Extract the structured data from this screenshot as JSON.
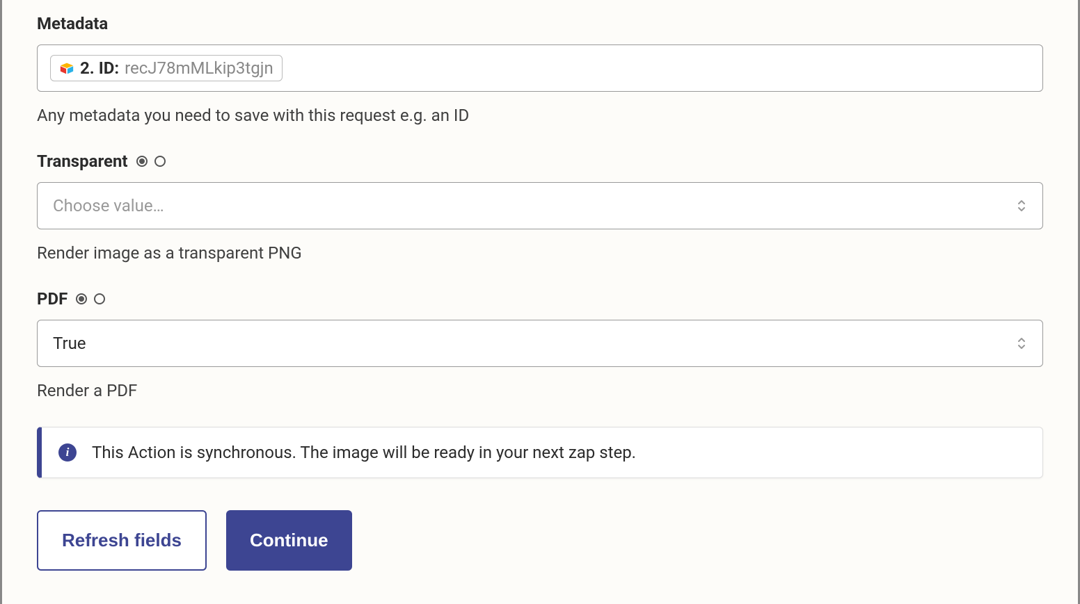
{
  "metadata": {
    "label": "Metadata",
    "pill_label": "2. ID:",
    "pill_value": "recJ78mMLkip3tgjn",
    "help": "Any metadata you need to save with this request e.g. an ID"
  },
  "transparent": {
    "label": "Transparent",
    "placeholder": "Choose value…",
    "help": "Render image as a transparent PNG"
  },
  "pdf": {
    "label": "PDF",
    "value": "True",
    "help": "Render a PDF"
  },
  "alert": {
    "text": "This Action is synchronous. The image will be ready in your next zap step."
  },
  "buttons": {
    "refresh": "Refresh fields",
    "continue": "Continue"
  }
}
